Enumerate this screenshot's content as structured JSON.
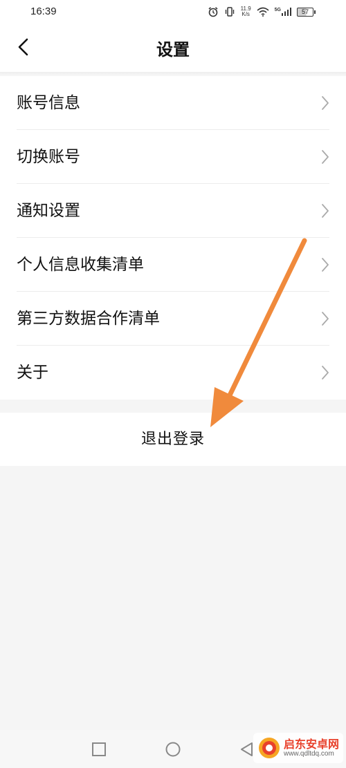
{
  "status_bar": {
    "time": "16:39",
    "net_speed_value": "11.9",
    "net_speed_unit": "K/s",
    "network_type": "5G",
    "battery_level": "57"
  },
  "header": {
    "title": "设置",
    "back_icon": "chevron-left-icon"
  },
  "menu": {
    "items": [
      {
        "label": "账号信息"
      },
      {
        "label": "切换账号"
      },
      {
        "label": "通知设置"
      },
      {
        "label": "个人信息收集清单"
      },
      {
        "label": "第三方数据合作清单"
      },
      {
        "label": "关于"
      }
    ]
  },
  "logout": {
    "label": "退出登录"
  },
  "annotation": {
    "arrow_color": "#f08a3c"
  },
  "nav_bar": {
    "buttons": [
      "recent-apps-icon",
      "home-icon",
      "back-triangle-icon"
    ]
  },
  "watermark": {
    "title": "启东安卓网",
    "url": "www.qdltdq.com"
  }
}
